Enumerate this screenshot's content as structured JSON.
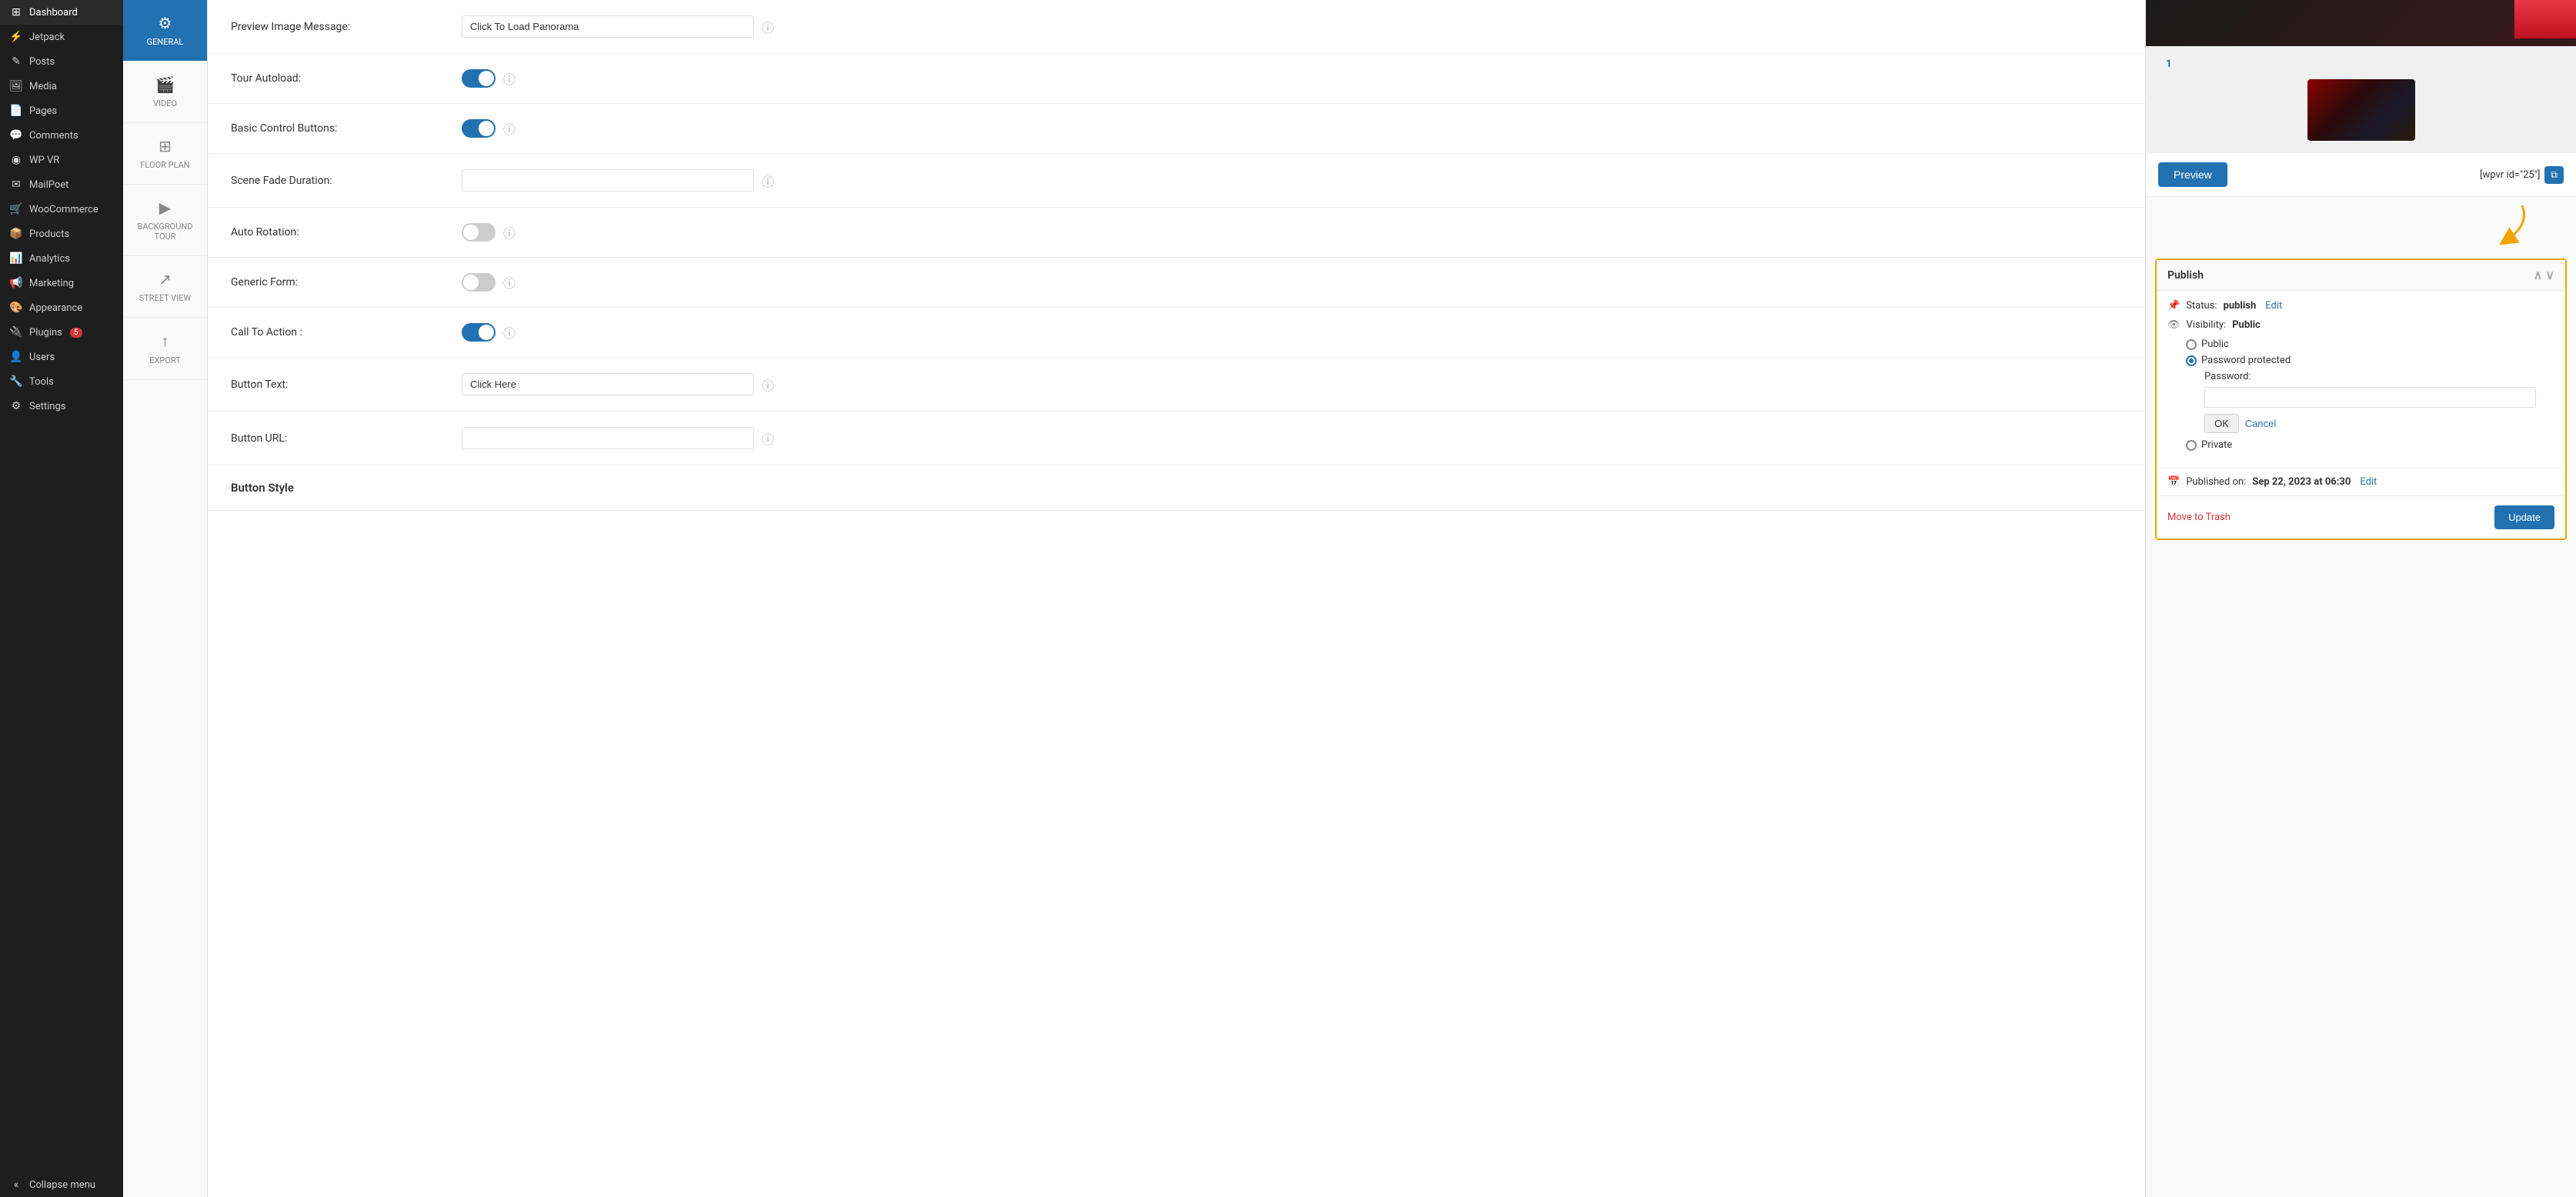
{
  "sidebar": {
    "items": [
      {
        "id": "dashboard",
        "label": "Dashboard",
        "icon": "⊞"
      },
      {
        "id": "jetpack",
        "label": "Jetpack",
        "icon": "⚡"
      },
      {
        "id": "posts",
        "label": "Posts",
        "icon": "✎"
      },
      {
        "id": "media",
        "label": "Media",
        "icon": "🖼"
      },
      {
        "id": "pages",
        "label": "Pages",
        "icon": "📄"
      },
      {
        "id": "comments",
        "label": "Comments",
        "icon": "💬"
      },
      {
        "id": "wp-vr",
        "label": "WP VR",
        "icon": "◉"
      },
      {
        "id": "mailpoet",
        "label": "MailPoet",
        "icon": "✉"
      },
      {
        "id": "woocommerce",
        "label": "WooCommerce",
        "icon": "🛒"
      },
      {
        "id": "products",
        "label": "Products",
        "icon": "📦"
      },
      {
        "id": "analytics",
        "label": "Analytics",
        "icon": "📊"
      },
      {
        "id": "marketing",
        "label": "Marketing",
        "icon": "📢"
      },
      {
        "id": "appearance",
        "label": "Appearance",
        "icon": "🎨"
      },
      {
        "id": "plugins",
        "label": "Plugins",
        "icon": "🔌",
        "badge": "5"
      },
      {
        "id": "users",
        "label": "Users",
        "icon": "👤"
      },
      {
        "id": "tools",
        "label": "Tools",
        "icon": "🔧"
      },
      {
        "id": "settings",
        "label": "Settings",
        "icon": "⚙"
      }
    ],
    "collapse_label": "Collapse menu"
  },
  "sub_sidebar": {
    "tabs": [
      {
        "id": "general",
        "label": "GENERAL",
        "icon": "⚙",
        "active": true
      },
      {
        "id": "video",
        "label": "VIDEO",
        "icon": "🎬",
        "active": false
      },
      {
        "id": "floor_plan",
        "label": "FLOOR PLAN",
        "icon": "⊞",
        "active": false
      },
      {
        "id": "background_tour",
        "label": "BACKGROUND TOUR",
        "icon": "▶",
        "active": false
      },
      {
        "id": "street_view",
        "label": "STREET VIEW",
        "icon": "↗",
        "active": false
      },
      {
        "id": "export",
        "label": "EXPORT",
        "icon": "↑",
        "active": false
      }
    ]
  },
  "form": {
    "fields": [
      {
        "id": "preview_image_message",
        "label": "Preview Image Message:",
        "type": "text",
        "value": "Click To Load Panorama"
      },
      {
        "id": "tour_autoload",
        "label": "Tour Autoload:",
        "type": "toggle",
        "value": true
      },
      {
        "id": "basic_control_buttons",
        "label": "Basic Control Buttons:",
        "type": "toggle",
        "value": true
      },
      {
        "id": "scene_fade_duration",
        "label": "Scene Fade Duration:",
        "type": "text",
        "value": ""
      },
      {
        "id": "auto_rotation",
        "label": "Auto Rotation:",
        "type": "toggle",
        "value": false
      },
      {
        "id": "generic_form",
        "label": "Generic Form:",
        "type": "toggle",
        "value": false
      },
      {
        "id": "call_to_action",
        "label": "Call To Action :",
        "type": "toggle",
        "value": true
      },
      {
        "id": "button_text",
        "label": "Button Text:",
        "type": "text",
        "value": "Click Here"
      },
      {
        "id": "button_url",
        "label": "Button URL:",
        "type": "text",
        "value": ""
      },
      {
        "id": "button_style",
        "label": "Button Style",
        "type": "header"
      }
    ]
  },
  "right_panel": {
    "scene_number": "1",
    "preview_button_label": "Preview",
    "shortcode_text": "[wpvr id=\"25\"]",
    "publish": {
      "title": "Publish",
      "status_label": "Status:",
      "status_value": "publish",
      "status_edit": "Edit",
      "visibility_label": "Visibility:",
      "visibility_value": "Public",
      "options": [
        {
          "id": "public",
          "label": "Public",
          "selected": false
        },
        {
          "id": "password_protected",
          "label": "Password protected",
          "selected": true
        },
        {
          "id": "private",
          "label": "Private",
          "selected": false
        }
      ],
      "password_label": "Password:",
      "password_value": "",
      "ok_label": "OK",
      "cancel_label": "Cancel",
      "published_on_label": "Published on:",
      "published_on_value": "Sep 22, 2023 at 06:30",
      "edit_label": "Edit",
      "move_trash_label": "Move to Trash",
      "update_label": "Update"
    }
  }
}
